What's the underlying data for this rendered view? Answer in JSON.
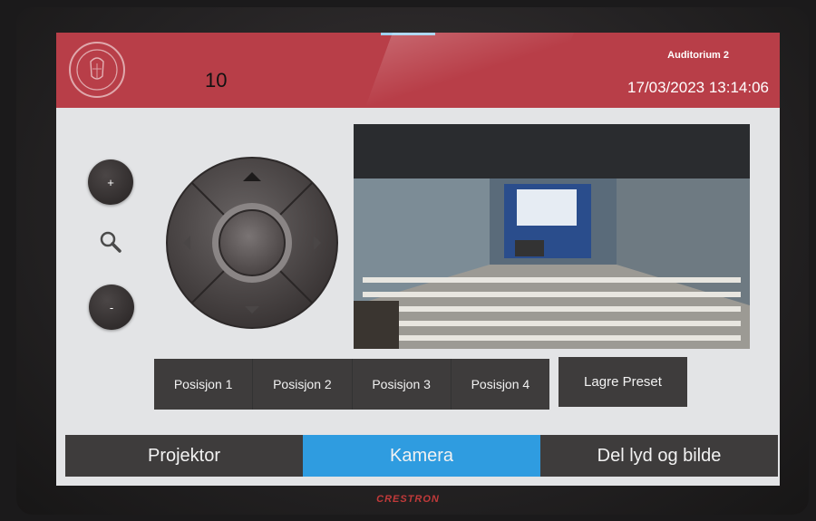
{
  "header": {
    "number": "10",
    "room": "Auditorium 2",
    "datetime": "17/03/2023 13:14:06"
  },
  "zoom": {
    "in_label": "+",
    "out_label": "-"
  },
  "presets": [
    "Posisjon 1",
    "Posisjon 2",
    "Posisjon 3",
    "Posisjon 4"
  ],
  "save_preset": "Lagre Preset",
  "nav": {
    "tabs": [
      "Projektor",
      "Kamera",
      "Del lyd og bilde"
    ],
    "active": "Kamera"
  },
  "brand": "CRESTRON",
  "colors": {
    "header": "#b83e48",
    "active_tab": "#2f9ce0",
    "button": "#3e3c3c"
  }
}
